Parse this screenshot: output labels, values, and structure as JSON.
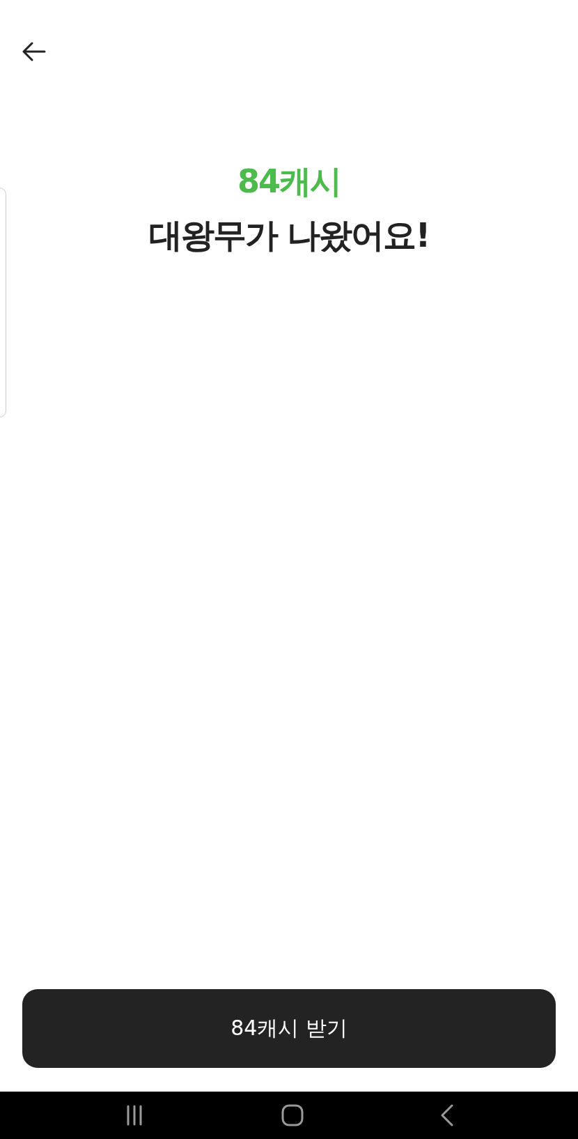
{
  "reward": {
    "amount": "84캐시",
    "message": "대왕무가 나왔어요!"
  },
  "button": {
    "label": "84캐시 받기"
  }
}
